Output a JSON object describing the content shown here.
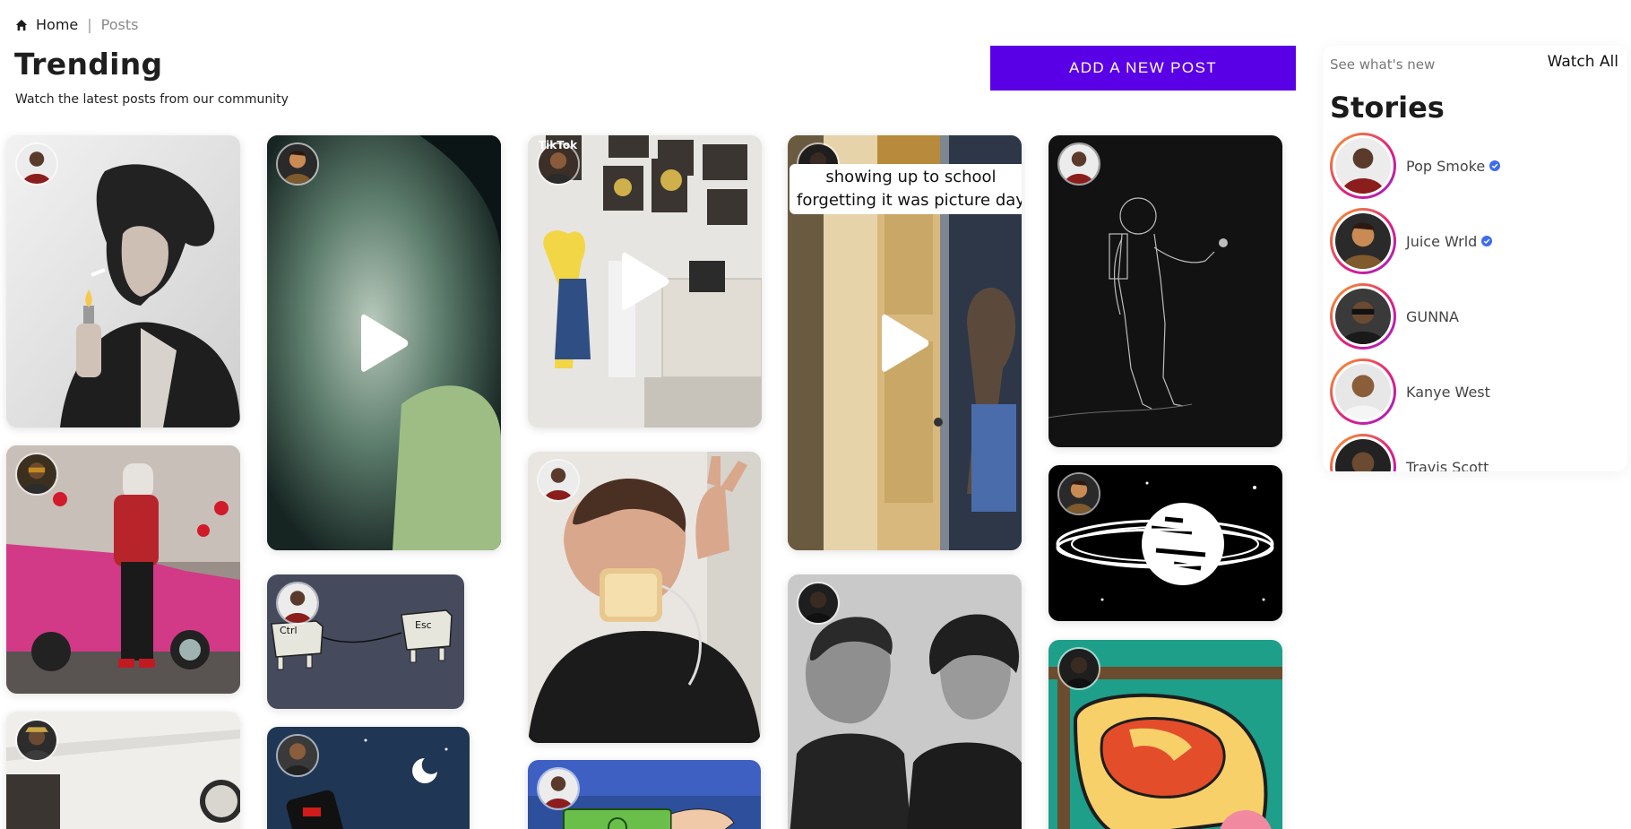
{
  "breadcrumb": {
    "home": "Home",
    "separator": "|",
    "current": "Posts"
  },
  "header": {
    "title": "Trending",
    "subtitle": "Watch the latest posts from our community"
  },
  "actions": {
    "add_post": "ADD A NEW POST"
  },
  "stories": {
    "see_new": "See what's new",
    "watch_all": "Watch All",
    "title": "Stories",
    "items": [
      {
        "name": "Pop Smoke",
        "verified": true
      },
      {
        "name": "Juice Wrld",
        "verified": true
      },
      {
        "name": "GUNNA",
        "verified": false
      },
      {
        "name": "Kanye West",
        "verified": false
      },
      {
        "name": "Travis Scott",
        "verified": false
      }
    ]
  },
  "posts": [
    {
      "id": "cole-sprouse-lighter",
      "type": "image"
    },
    {
      "id": "pink-car-red-jacket",
      "type": "image"
    },
    {
      "id": "room-with-clock",
      "type": "image"
    },
    {
      "id": "smoke-video",
      "type": "video"
    },
    {
      "id": "ctrl-esc-meme",
      "type": "image"
    },
    {
      "id": "phone-battery-moon",
      "type": "image"
    },
    {
      "id": "mr-burns-room-video",
      "type": "video",
      "overlay_text": "TikTok"
    },
    {
      "id": "bread-mask-selfie",
      "type": "image"
    },
    {
      "id": "money-cartoon",
      "type": "image"
    },
    {
      "id": "picture-day-video",
      "type": "video",
      "caption_line1": "showing up to school",
      "caption_line2": "forgetting it was picture day"
    },
    {
      "id": "couple-portrait",
      "type": "image"
    },
    {
      "id": "astronaut-sketch",
      "type": "image"
    },
    {
      "id": "saturn-planet",
      "type": "image"
    },
    {
      "id": "patrick-meme",
      "type": "image"
    }
  ],
  "colors": {
    "accent": "#5a00e6",
    "verified": "#3d6cf0",
    "story_ring_start": "#f7a325",
    "story_ring_end": "#9b1fd1"
  }
}
